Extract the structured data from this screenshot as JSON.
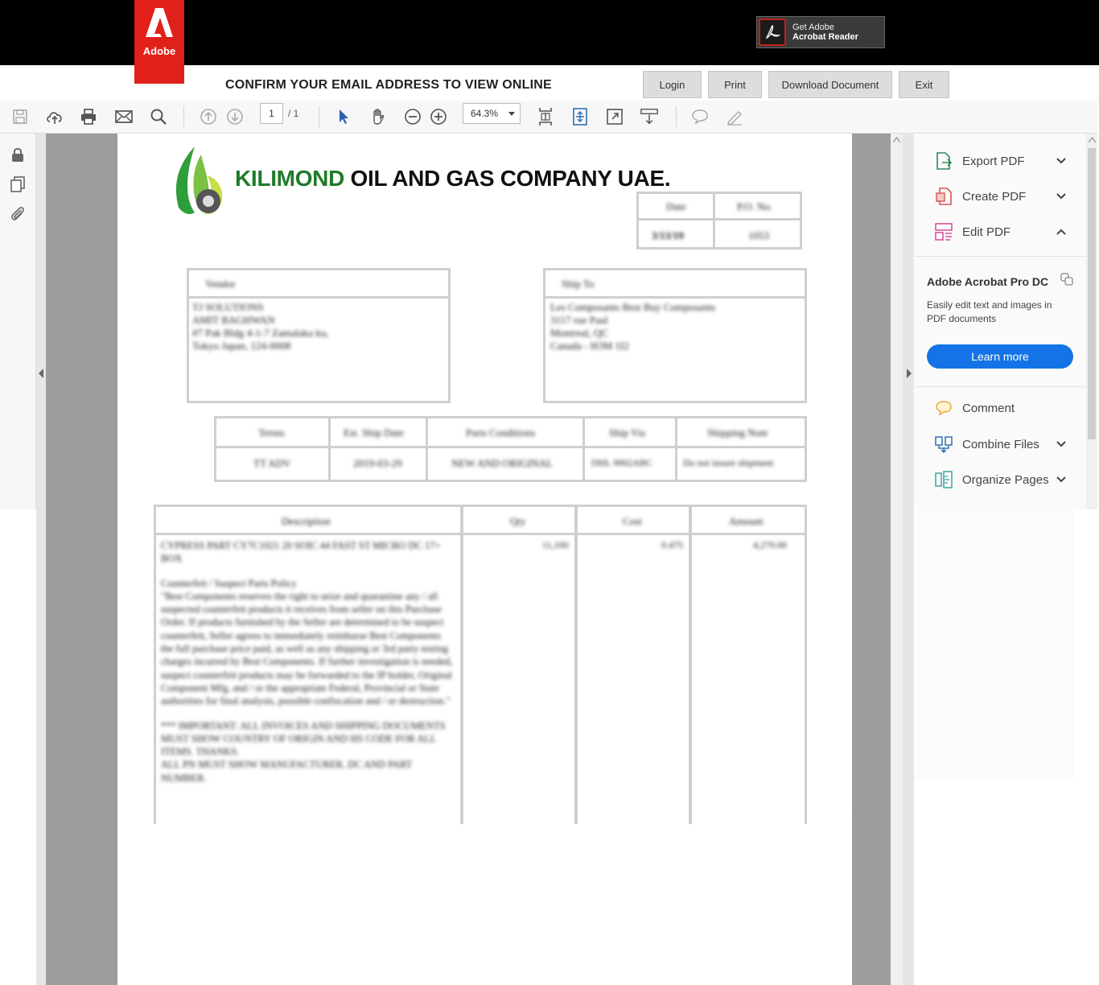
{
  "topbar": {
    "adobe_logo_text": "Adobe",
    "get_reader_line1": "Get Adobe",
    "get_reader_line2": "Acrobat Reader"
  },
  "header": {
    "confirm_text": "CONFIRM YOUR EMAIL ADDRESS TO VIEW ONLINE",
    "buttons": {
      "login": "Login",
      "print": "Print",
      "download": "Download Document",
      "exit": "Exit"
    }
  },
  "toolbar": {
    "page_current": "1",
    "page_total": "/ 1",
    "zoom": "64.3%",
    "icons": [
      "save-icon",
      "upload-icon",
      "print-icon",
      "email-icon",
      "search-icon",
      "page-up-icon",
      "page-down-icon",
      "select-arrow-icon",
      "hand-icon",
      "zoom-out-icon",
      "zoom-in-icon",
      "fit-page-icon",
      "scroll-mode-icon",
      "full-screen-icon",
      "read-mode-icon",
      "comment-icon",
      "sign-icon"
    ]
  },
  "left_rail": {
    "icons": [
      "lock-icon",
      "pages-icon",
      "attachment-icon"
    ]
  },
  "document": {
    "company_prefix": "KILIMOND",
    "company_rest": " OIL AND GAS COMPANY UAE.",
    "date_header": "Date",
    "po_header": "P.O. No.",
    "date_value": "3/13/19",
    "po_value": "1053",
    "vendor_header": "Vendor",
    "vendor_lines": [
      "TJ SOLUTIONS",
      "AMIT BAGHWAN",
      "#7 Pak Bldg 4-1-7 Zamalaka ku,",
      "Tokyo Japan, 124-0008"
    ],
    "shipto_header": "Ship To",
    "shipto_lines": [
      "Les Composants Best Buy Composants",
      "3117 rue Paul",
      "Montreal, QC",
      "Canada - H3M 1I2"
    ],
    "terms_headers": [
      "Terms",
      "Est. Ship Date",
      "Parts Conditions",
      "Ship Via",
      "Shipping Note"
    ],
    "terms_values": [
      "TT ADV",
      "2019-03-29",
      "NEW AND ORIGINAL",
      "DHL 9902ABC",
      "Do not insure shipment"
    ],
    "items_headers": [
      "Description",
      "Qty",
      "Cost",
      "Amount"
    ],
    "item_description": "CYPRESS PART CY7C1021 20 SOIC 44 FAST ST MICRO DC 17+ BOX",
    "item_qty": "11,100",
    "item_cost": "0.475",
    "item_amount": "4,270.00",
    "item_notes": [
      "Counterfeit / Suspect Parts Policy",
      "\"Best Components reserves the right to seize and quarantine any / all suspected counterfeit products it receives from seller on this Purchase Order. If products furnished by the Seller are determined to be suspect counterfeit, Seller agrees to immediately reimburse Best Components the full purchase price paid, as well as any shipping or 3rd party testing charges incurred by Best Components. If further investigation is needed, suspect counterfeit products may be forwarded to the IP holder, Original Component Mfg, and / or the appropriate Federal, Provincial or State authorities for final analysis, possible confiscation and / or destruction.\"",
      "*** IMPORTANT: ALL INVOICES AND SHIPPING DOCUMENTS MUST SHOW COUNTRY OF ORIGIN AND HS CODE FOR ALL ITEMS. THANKS.",
      "ALL PN MUST SHOW MANUFACTURER, DC AND PART NUMBER."
    ]
  },
  "right_panel": {
    "tools_top": [
      {
        "label": "Export PDF",
        "icon": "export-pdf-icon",
        "chevron": "down"
      },
      {
        "label": "Create PDF",
        "icon": "create-pdf-icon",
        "chevron": "down"
      },
      {
        "label": "Edit PDF",
        "icon": "edit-pdf-icon",
        "chevron": "up"
      }
    ],
    "promo_title": "Adobe Acrobat Pro DC",
    "promo_desc": "Easily edit text and images in PDF documents",
    "learn_more": "Learn more",
    "tools_bottom": [
      {
        "label": "Comment",
        "icon": "comment-bubble-icon",
        "chevron": ""
      },
      {
        "label": "Combine Files",
        "icon": "combine-files-icon",
        "chevron": "down"
      },
      {
        "label": "Organize Pages",
        "icon": "organize-pages-icon",
        "chevron": "down"
      }
    ]
  },
  "colors": {
    "accent_blue": "#1473e6",
    "adobe_red": "#e0201b",
    "company_green": "#1f7a2a"
  }
}
